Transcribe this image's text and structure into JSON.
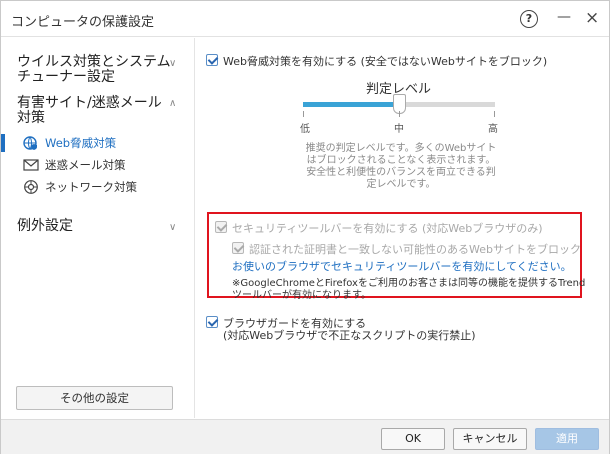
{
  "window": {
    "title": "コンピュータの保護設定",
    "help_glyph": "?",
    "min_glyph": "—",
    "close_glyph": "×"
  },
  "sidebar": {
    "groups": [
      {
        "label_line1": "ウイルス対策とシステム",
        "label_line2": "チューナー設定",
        "chevron": "∨"
      },
      {
        "label_line1": "有害サイト/迷惑メール",
        "label_line2": "対策",
        "chevron": "∧"
      },
      {
        "label_line1": "例外設定",
        "chevron": "∨"
      }
    ],
    "items": [
      {
        "label": "Web脅威対策",
        "icon": "globe-shield-icon",
        "active": true
      },
      {
        "label": "迷惑メール対策",
        "icon": "envelope-icon",
        "active": false
      },
      {
        "label": "ネットワーク対策",
        "icon": "network-globe-icon",
        "active": false
      }
    ],
    "other_settings_label": "その他の設定"
  },
  "main": {
    "web_threat_checkbox_label": "Web脅威対策を有効にする (安全ではないWebサイトをブロック)",
    "level_title": "判定レベル",
    "level_value": 0.5,
    "level_labels": [
      "低",
      "中",
      "高"
    ],
    "level_desc": [
      "推奨の判定レベルです。多くのWebサイト",
      "はブロックされることなく表示されます。",
      "安全性と利便性のバランスを両立できる判",
      "定レベルです。"
    ],
    "toolbar_checkbox_label": "セキュリティツールバーを有効にする (対応Webブラウザのみ)",
    "cert_checkbox_label": "認証された証明書と一致しない可能性のあるWebサイトをブロック",
    "enable_toolbar_notice": "お使いのブラウザでセキュリティツールバーを有効にしてください。",
    "note_line1": "※GoogleChromeとFirefoxをご利用のお客さまは同等の機能を提供するTrend",
    "note_line2": "ツールバーが有効になります。",
    "browser_guard_label_line1": "ブラウザガードを有効にする",
    "browser_guard_label_line2": "(対応Webブラウザで不正なスクリプトの実行禁止)"
  },
  "footer": {
    "ok_label": "OK",
    "cancel_label": "キャンセル",
    "apply_label": "適用"
  },
  "colors": {
    "accent": "#1f6fc1",
    "slider_fill": "#3aa3d6",
    "highlight_border": "#e0141e",
    "apply_disabled": "#a6c6e6"
  }
}
